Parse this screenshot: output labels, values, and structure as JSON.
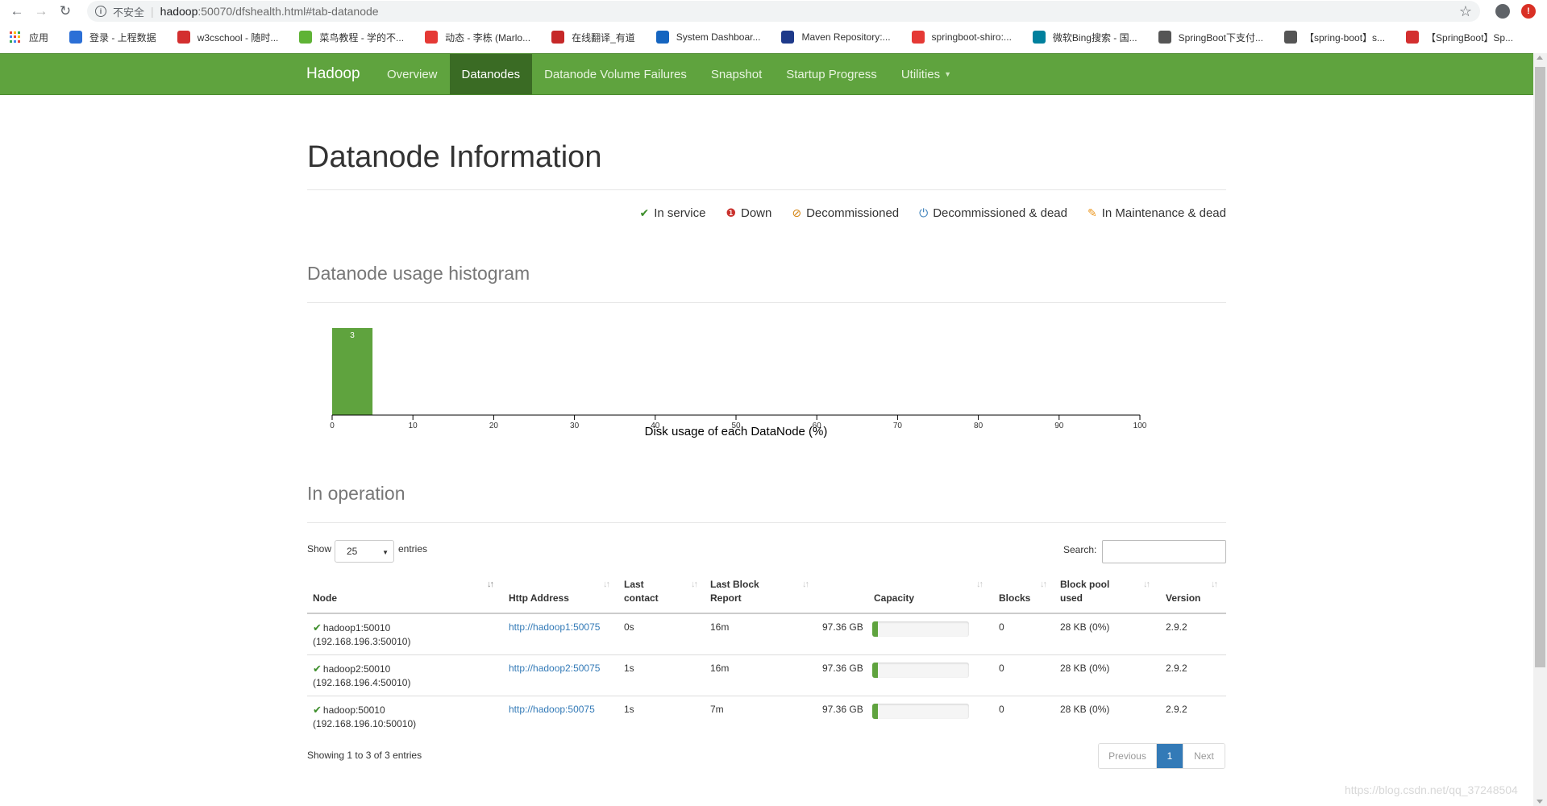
{
  "browser": {
    "not_secure": "不安全",
    "url_host": "hadoop",
    "url_rest": ":50070/dfshealth.html#tab-datanode",
    "bookmarks": [
      {
        "label": "应用",
        "color": "#4285f4"
      },
      {
        "label": "登录 - 上程数据",
        "color": "#2b6fd6"
      },
      {
        "label": "w3cschool - 随时...",
        "color": "#d32f2f"
      },
      {
        "label": "菜鸟教程 - 学的不...",
        "color": "#5fb336"
      },
      {
        "label": "动态 - 李栋 (Marlo...",
        "color": "#e53935"
      },
      {
        "label": "在线翻译_有道",
        "color": "#c62828"
      },
      {
        "label": "System Dashboar...",
        "color": "#1565c0"
      },
      {
        "label": "Maven Repository:...",
        "color": "#1e3a8a"
      },
      {
        "label": "springboot-shiro:...",
        "color": "#e53935"
      },
      {
        "label": "微软Bing搜索 - 国...",
        "color": "#00809d"
      },
      {
        "label": "SpringBoot下支付...",
        "color": "#555555"
      },
      {
        "label": "【spring-boot】s...",
        "color": "#555555"
      },
      {
        "label": "【SpringBoot】Sp...",
        "color": "#d32f2f"
      }
    ]
  },
  "navbar": {
    "brand": "Hadoop",
    "items": [
      {
        "label": "Overview"
      },
      {
        "label": "Datanodes"
      },
      {
        "label": "Datanode Volume Failures"
      },
      {
        "label": "Snapshot"
      },
      {
        "label": "Startup Progress"
      },
      {
        "label": "Utilities"
      }
    ],
    "active": "Datanodes"
  },
  "page": {
    "title": "Datanode Information"
  },
  "legend": [
    {
      "icon": "check-icon",
      "glyph": "✔",
      "color": "#3c8d2a",
      "label": "In service"
    },
    {
      "icon": "exclamation-icon",
      "glyph": "❶",
      "color": "#c9302c",
      "label": "Down"
    },
    {
      "icon": "ban-icon",
      "glyph": "⊘",
      "color": "#d58512",
      "label": "Decommissioned"
    },
    {
      "icon": "power-icon",
      "glyph": "⏻",
      "color": "#337ab7",
      "label": "Decommissioned & dead"
    },
    {
      "icon": "wrench-icon",
      "glyph": "✎",
      "color": "#ec971f",
      "label": "In Maintenance & dead"
    }
  ],
  "histogram": {
    "section_title": "Datanode usage histogram",
    "chart_data": {
      "type": "bar",
      "title": "",
      "xlabel": "Disk usage of each DataNode (%)",
      "ylabel": "",
      "xlim": [
        0,
        100
      ],
      "x_ticks": [
        "0",
        "10",
        "20",
        "30",
        "40",
        "50",
        "60",
        "70",
        "80",
        "90",
        "100"
      ],
      "bins": [
        {
          "x0": 0,
          "x1": 5,
          "count": 3
        }
      ],
      "color": "#5fa33e"
    }
  },
  "operation": {
    "section_title": "In operation",
    "show_label": "Show",
    "entries_label": "entries",
    "page_length": "25",
    "search_label": "Search:",
    "search_value": "",
    "columns": [
      {
        "line1": "",
        "line2": "Node"
      },
      {
        "line1": "",
        "line2": "Http Address"
      },
      {
        "line1": "Last",
        "line2": "contact"
      },
      {
        "line1": "Last Block",
        "line2": "Report"
      },
      {
        "line1": "",
        "line2": "Capacity"
      },
      {
        "line1": "",
        "line2": "Blocks"
      },
      {
        "line1": "Block pool",
        "line2": "used"
      },
      {
        "line1": "",
        "line2": "Version"
      }
    ],
    "rows": [
      {
        "node": "hadoop1:50010",
        "ip": "(192.168.196.3:50010)",
        "http": "http://hadoop1:50075",
        "last_contact": "0s",
        "last_block_report": "16m",
        "capacity": "97.36 GB",
        "usage_pct": 6,
        "blocks": "0",
        "pool_used": "28 KB (0%)",
        "version": "2.9.2"
      },
      {
        "node": "hadoop2:50010",
        "ip": "(192.168.196.4:50010)",
        "http": "http://hadoop2:50075",
        "last_contact": "1s",
        "last_block_report": "16m",
        "capacity": "97.36 GB",
        "usage_pct": 6,
        "blocks": "0",
        "pool_used": "28 KB (0%)",
        "version": "2.9.2"
      },
      {
        "node": "hadoop:50010",
        "ip": "(192.168.196.10:50010)",
        "http": "http://hadoop:50075",
        "last_contact": "1s",
        "last_block_report": "7m",
        "capacity": "97.36 GB",
        "usage_pct": 6,
        "blocks": "0",
        "pool_used": "28 KB (0%)",
        "version": "2.9.2"
      }
    ],
    "info": "Showing 1 to 3 of 3 entries",
    "pager": {
      "previous": "Previous",
      "current": "1",
      "next": "Next"
    }
  },
  "watermark": "https://blog.csdn.net/qq_37248504"
}
